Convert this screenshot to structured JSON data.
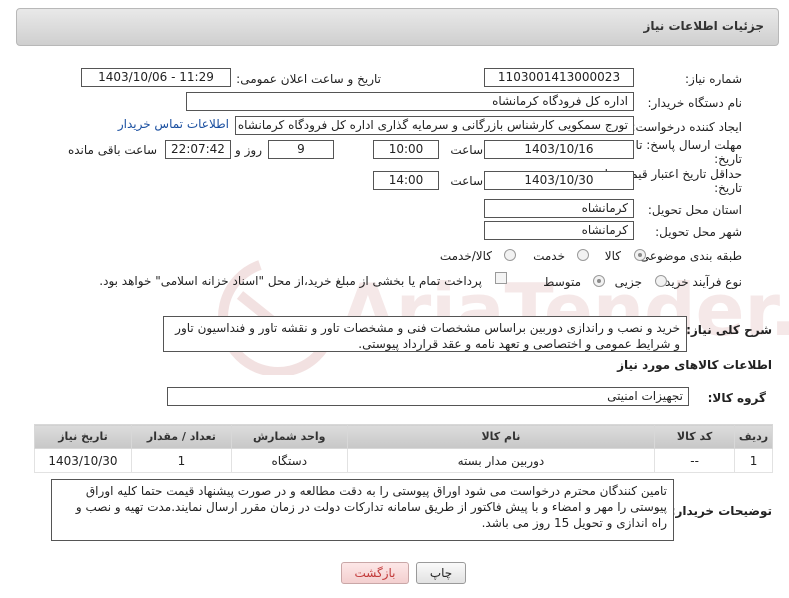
{
  "header": {
    "title": "جزئیات اطلاعات نیاز"
  },
  "form": {
    "need_number_label": "شماره نیاز:",
    "need_number": "1103001413000023",
    "announce_label": "تاریخ و ساعت اعلان عمومی:",
    "announce_value": "1403/10/06 - 11:29",
    "buyer_org_label": "نام دستگاه خریدار:",
    "buyer_org": "اداره کل فرودگاه کرمانشاه",
    "requester_label": "ایجاد کننده درخواست:",
    "requester": "تورج سمکویی کارشناس بازرگانی و سرمایه گذاری اداره کل فرودگاه کرمانشاه",
    "contact_link": "اطلاعات تماس خریدار",
    "deadline_label_1": "مهلت ارسال پاسخ: تا",
    "deadline_label_2": "تاریخ:",
    "deadline_date": "1403/10/16",
    "time_label": "ساعت",
    "deadline_time": "10:00",
    "days_value": "9",
    "days_label": "روز و",
    "remaining_value": "22:07:42",
    "remaining_label": "ساعت باقی مانده",
    "validity_label_1": "حداقل تاریخ اعتبار قیمت: تا",
    "validity_label_2": "تاریخ:",
    "validity_date": "1403/10/30",
    "validity_time": "14:00",
    "province_label": "استان محل تحویل:",
    "province": "کرمانشاه",
    "city_label": "شهر محل تحویل:",
    "city": "کرمانشاه",
    "category_label": "طبقه بندی موضوعی:",
    "category_goods": "کالا",
    "category_service": "خدمت",
    "category_both": "کالا/خدمت",
    "process_label": "نوع فرآیند خرید :",
    "process_partial": "جزیی",
    "process_medium": "متوسط",
    "payment_note": "پرداخت تمام یا بخشی از مبلغ خرید،از محل \"اسناد خزانه اسلامی\" خواهد بود."
  },
  "description": {
    "label": "شرح کلی نیاز:",
    "text": "خرید و نصب و راندازی دوربین براساس مشخصات فنی و مشخصات تاور و نقشه تاور و فنداسیون تاور و شرایط عمومی و اختصاصی و تعهد نامه و عقد قرارداد پیوستی."
  },
  "goods_section": {
    "title": "اطلاعات کالاهای مورد نیاز",
    "group_label": "گروه کالا:",
    "group_value": "تجهیزات امنیتی"
  },
  "table": {
    "headers": [
      "ردیف",
      "کد کالا",
      "نام کالا",
      "واحد شمارش",
      "تعداد / مقدار",
      "تاریخ نیاز"
    ],
    "rows": [
      [
        "1",
        "--",
        "دوربین مدار بسته",
        "دستگاه",
        "1",
        "1403/10/30"
      ]
    ]
  },
  "buyer_notes": {
    "label": "توضیحات خریدار:",
    "text": "تامین کنندگان محترم درخواست می شود اوراق پیوستی را به دقت مطالعه و در صورت پیشنهاد قیمت حتما کلیه اوراق پیوستی را مهر و امضاء و با پیش فاکتور از طریق سامانه تدارکات دولت در زمان مقرر ارسال نمایند.مدت تهیه و نصب و راه اندازی و تحویل 15 روز می باشد."
  },
  "buttons": {
    "print": "چاپ",
    "back": "بازگشت"
  },
  "colors": {
    "link": "#1a4fa0",
    "back_text": "#c23a3a",
    "header_bg": "#d9d9d9"
  }
}
